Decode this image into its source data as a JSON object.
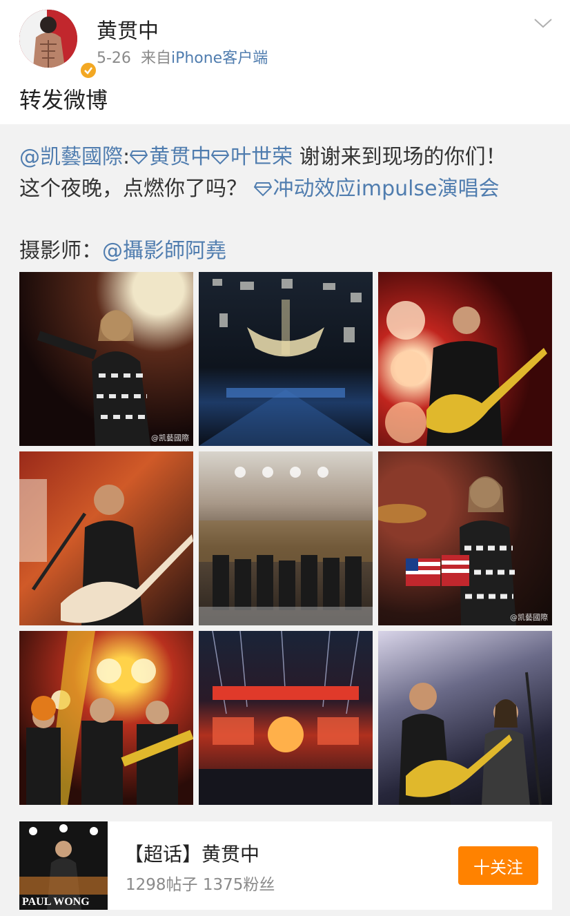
{
  "post": {
    "user_name": "黄贯中",
    "date": "5-26",
    "source_prefix": "来自",
    "source_app": "iPhone客户端",
    "repost_text": "转发微博"
  },
  "retweet": {
    "author": "@凯藝國際",
    "colon": ":",
    "tag1": "黄贯中",
    "tag2": "叶世荣",
    "text1": " 谢谢来到现场的你们！",
    "text2": "这个夜晚，点燃你了吗？",
    "tag3": "冲动效应impulse演唱会",
    "photographer_label": "摄影师：",
    "photographer": "@攝影師阿堯"
  },
  "photos": [
    {
      "name": "photo-singer-pointing",
      "watermark": "@凯藝國際"
    },
    {
      "name": "photo-stage-chandelier",
      "watermark": ""
    },
    {
      "name": "photo-guitarist-red",
      "watermark": ""
    },
    {
      "name": "photo-guitarist-singing",
      "watermark": ""
    },
    {
      "name": "photo-crowd-bow",
      "watermark": ""
    },
    {
      "name": "photo-drummer",
      "watermark": "@凯藝國際"
    },
    {
      "name": "photo-band-trio",
      "watermark": ""
    },
    {
      "name": "photo-stage-lights",
      "watermark": ""
    },
    {
      "name": "photo-two-guitarists",
      "watermark": ""
    }
  ],
  "topic": {
    "title": "【超话】黄贯中",
    "stats": "1298帖子 1375粉丝",
    "follow_label": "十关注",
    "thumb_text": "PAUL WONG"
  },
  "colors": {
    "link": "#507daf",
    "follow": "#ff8200",
    "verify": "#f3a823"
  }
}
